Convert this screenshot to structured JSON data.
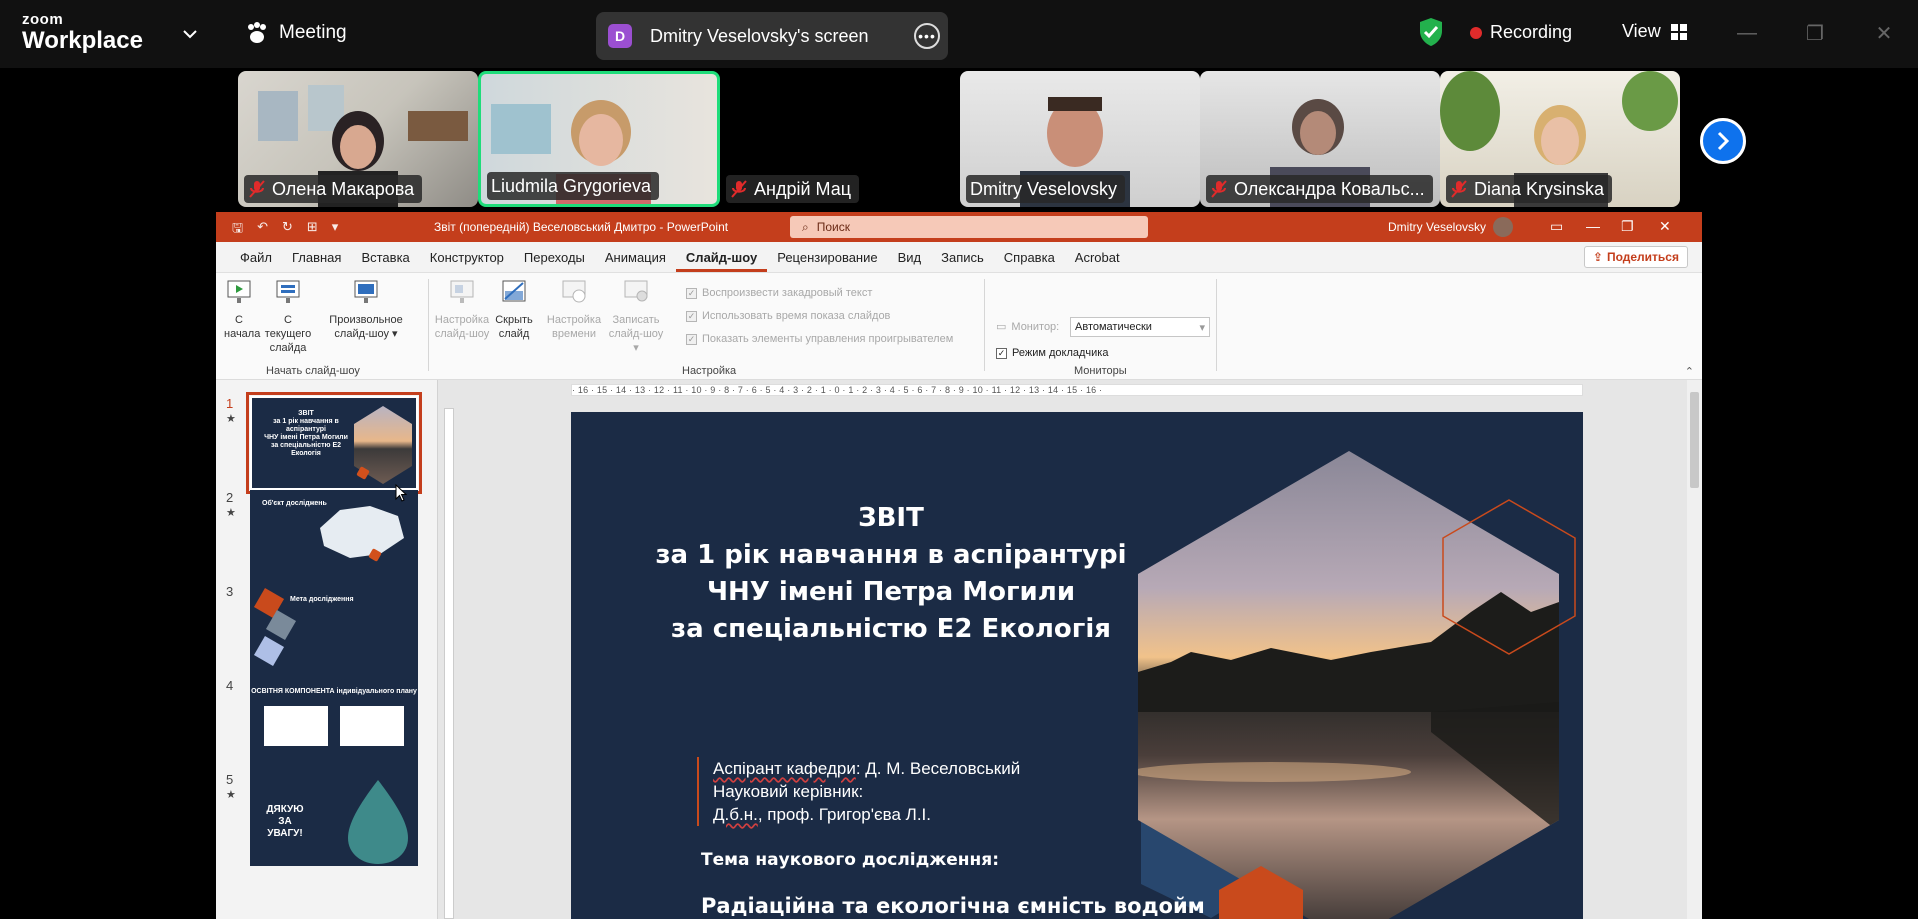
{
  "zoom": {
    "logo_top": "zoom",
    "logo_bottom": "Workplace",
    "meeting_label": "Meeting",
    "share_badge": "D",
    "share_title": "Dmitry Veselovsky's screen",
    "recording_label": "Recording",
    "view_label": "View"
  },
  "participants": [
    {
      "name": "Олена Макарова",
      "muted": true
    },
    {
      "name": "Liudmila Grygorieva",
      "muted": false,
      "active_speaker": true
    },
    {
      "name": "Андрій Мац",
      "muted": true
    },
    {
      "name": "Dmitry Veselovsky",
      "muted": false
    },
    {
      "name": "Олександра Ковальс...",
      "muted": true
    },
    {
      "name": "Diana Krysinska",
      "muted": true
    }
  ],
  "ppt": {
    "doc_title": "Звіт (попередній) Веселовський Дмитро  -  PowerPoint",
    "search_placeholder": "Поиск",
    "user_name": "Dmitry Veselovsky",
    "menu": [
      "Файл",
      "Главная",
      "Вставка",
      "Конструктор",
      "Переходы",
      "Анимация",
      "Слайд-шоу",
      "Рецензирование",
      "Вид",
      "Запись",
      "Справка",
      "Acrobat"
    ],
    "active_menu": "Слайд-шоу",
    "share_label": "Поделиться",
    "ribbon": {
      "from_start_1": "С",
      "from_start_2": "начала",
      "from_current_1": "С текущего",
      "from_current_2": "слайда",
      "custom_1": "Произвольное",
      "custom_2": "слайд-шоу",
      "group_start": "Начать слайд-шоу",
      "setup_1": "Настройка",
      "setup_2": "слайд-шоу",
      "hide_1": "Скрыть",
      "hide_2": "слайд",
      "timing_1": "Настройка",
      "timing_2": "времени",
      "record_1": "Записать",
      "record_2": "слайд-шоу",
      "chk_narration": "Воспроизвести закадровый текст",
      "chk_timings": "Использовать время показа слайдов",
      "chk_media": "Показать элементы управления проигрывателем",
      "group_setup": "Настройка",
      "monitor_label": "Монитор:",
      "monitor_value": "Автоматически",
      "presenter_view": "Режим докладчика",
      "group_monitors": "Мониторы"
    },
    "ruler_text": "· 16 · 15 · 14 · 13 · 12 · 11 · 10 · 9 · 8 · 7 · 6 · 5 · 4 · 3 · 2 · 1 · 0 · 1 · 2 · 3 · 4 · 5 · 6 · 7 · 8 · 9 · 10 · 11 · 12 · 13 · 14 · 15 · 16 ·",
    "thumbnails": [
      {
        "num": "1",
        "star": "★",
        "text": "ЗВІТ\nза 1 рік навчання в аспірантурі\nЧНУ імені Петра Могили\nза спеціальністю Е2 Екологія"
      },
      {
        "num": "2",
        "star": "★",
        "text": "Об'єкт досліджень"
      },
      {
        "num": "3",
        "star": "",
        "text": "Мета дослідження"
      },
      {
        "num": "4",
        "star": "",
        "text": "ОСВІТНЯ КОМПОНЕНТА індивідуального плану"
      },
      {
        "num": "5",
        "star": "★",
        "text": "ДЯКУЮ ЗА УВАГУ!"
      }
    ],
    "slide": {
      "title_1": "ЗВІТ",
      "title_2": "за 1 рік навчання в аспірантурі",
      "title_3": "ЧНУ імені Петра Могили",
      "title_4": "за спеціальністю Е2 Екологія",
      "author_label": "Аспірант кафедри",
      "author_value": ": Д. М. Веселовський",
      "supervisor_label": "Науковий керівник:",
      "supervisor_degree": "Д.б.н.",
      "supervisor_rest": ", проф. Григор'єва Л.І.",
      "topic_heading": "Тема наукового дослідження:",
      "topic_text": "Радіаційна та екологічна ємність водойм"
    }
  },
  "colors": {
    "ppt_red": "#c43e1c",
    "slide_bg": "#1b2b45",
    "zoom_blue": "#0e72ed",
    "active_speaker": "#1fdc7a",
    "record_red": "#e02b2b"
  }
}
